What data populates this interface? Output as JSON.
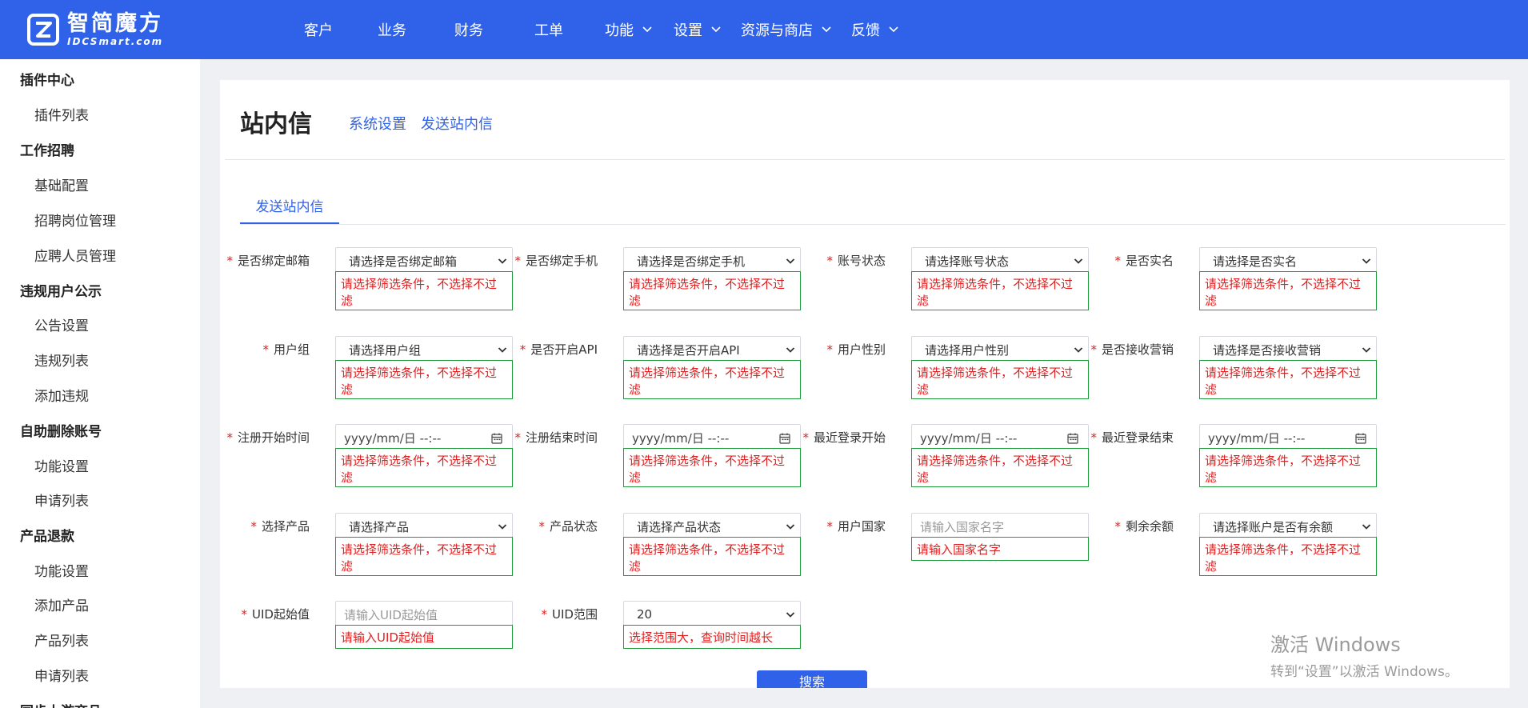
{
  "header": {
    "logo_cn": "智简魔方",
    "logo_en": "IDCSmart.com",
    "nav": [
      {
        "label": "客户",
        "has_dropdown": false
      },
      {
        "label": "业务",
        "has_dropdown": false
      },
      {
        "label": "财务",
        "has_dropdown": false
      },
      {
        "label": "工单",
        "has_dropdown": false
      },
      {
        "label": "功能",
        "has_dropdown": true
      },
      {
        "label": "设置",
        "has_dropdown": true
      },
      {
        "label": "资源与商店",
        "has_dropdown": true
      },
      {
        "label": "反馈",
        "has_dropdown": true
      }
    ]
  },
  "sidebar": {
    "groups": [
      {
        "title": "插件中心",
        "items": [
          "插件列表"
        ]
      },
      {
        "title": "工作招聘",
        "items": [
          "基础配置",
          "招聘岗位管理",
          "应聘人员管理"
        ]
      },
      {
        "title": "违规用户公示",
        "items": [
          "公告设置",
          "违规列表",
          "添加违规"
        ]
      },
      {
        "title": "自助删除账号",
        "items": [
          "功能设置",
          "申请列表"
        ]
      },
      {
        "title": "产品退款",
        "items": [
          "功能设置",
          "添加产品",
          "产品列表",
          "申请列表"
        ]
      },
      {
        "title": "同步上游商品",
        "items": []
      }
    ]
  },
  "page": {
    "title": "站内信",
    "links": [
      "系统设置",
      "发送站内信"
    ],
    "tab": "发送站内信"
  },
  "form": {
    "rows": [
      [
        {
          "label": "是否绑定邮箱",
          "type": "select",
          "value": "请选择是否绑定邮箱",
          "hint": "请选择筛选条件，不选择不过滤"
        },
        {
          "label": "是否绑定手机",
          "type": "select",
          "value": "请选择是否绑定手机",
          "hint": "请选择筛选条件，不选择不过滤"
        },
        {
          "label": "账号状态",
          "type": "select",
          "value": "请选择账号状态",
          "hint": "请选择筛选条件，不选择不过滤"
        },
        {
          "label": "是否实名",
          "type": "select",
          "value": "请选择是否实名",
          "hint": "请选择筛选条件，不选择不过滤"
        }
      ],
      [
        {
          "label": "用户组",
          "type": "select",
          "value": "请选择用户组",
          "hint": "请选择筛选条件，不选择不过滤"
        },
        {
          "label": "是否开启API",
          "type": "select",
          "value": "请选择是否开启API",
          "hint": "请选择筛选条件，不选择不过滤"
        },
        {
          "label": "用户性别",
          "type": "select",
          "value": "请选择用户性别",
          "hint": "请选择筛选条件，不选择不过滤"
        },
        {
          "label": "是否接收营销",
          "type": "select",
          "value": "请选择是否接收营销",
          "hint": "请选择筛选条件，不选择不过滤"
        }
      ],
      [
        {
          "label": "注册开始时间",
          "type": "date",
          "value": "yyyy/mm/日 --:--",
          "hint": "请选择筛选条件，不选择不过滤"
        },
        {
          "label": "注册结束时间",
          "type": "date",
          "value": "yyyy/mm/日 --:--",
          "hint": "请选择筛选条件，不选择不过滤"
        },
        {
          "label": "最近登录开始",
          "type": "date",
          "value": "yyyy/mm/日 --:--",
          "hint": "请选择筛选条件，不选择不过滤"
        },
        {
          "label": "最近登录结束",
          "type": "date",
          "value": "yyyy/mm/日 --:--",
          "hint": "请选择筛选条件，不选择不过滤"
        }
      ],
      [
        {
          "label": "选择产品",
          "type": "select",
          "value": "请选择产品",
          "hint": "请选择筛选条件，不选择不过滤"
        },
        {
          "label": "产品状态",
          "type": "select",
          "value": "请选择产品状态",
          "hint": "请选择筛选条件，不选择不过滤"
        },
        {
          "label": "用户国家",
          "type": "input",
          "value": "请输入国家名字",
          "hint": "请输入国家名字"
        },
        {
          "label": "剩余余额",
          "type": "select",
          "value": "请选择账户是否有余额",
          "hint": "请选择筛选条件，不选择不过滤"
        }
      ],
      [
        {
          "label": "UID起始值",
          "type": "input",
          "value": "请输入UID起始值",
          "hint": "请输入UID起始值"
        },
        {
          "label": "UID范围",
          "type": "select",
          "value": "20",
          "hint": "选择范围大，查询时间越长"
        }
      ]
    ],
    "search_label": "搜索"
  },
  "watermark": {
    "line1": "激活 Windows",
    "line2": "转到“设置”以激活 Windows。"
  },
  "colors": {
    "brand": "#2f62e9",
    "required": "#e02020",
    "hint_border": "#1f9b3c"
  }
}
